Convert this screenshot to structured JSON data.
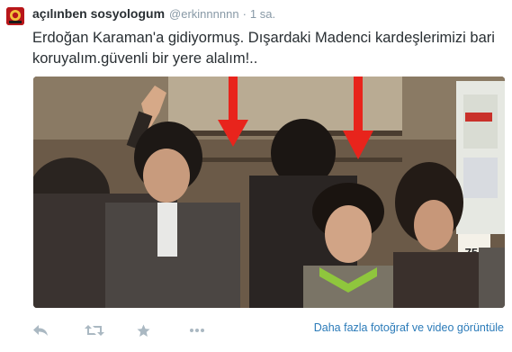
{
  "tweet": {
    "fullname": "açılınben sosyologum",
    "username": "@erkinnnnnn",
    "separator": "·",
    "time": "1 sa.",
    "text": "Erdoğan Karaman'a gidiyormuş. Dışardaki Madenci kardeşlerimizi bari koruyalım.güvenli bir yere alalım!..",
    "media": {
      "content": "photo",
      "sign_text": ".75",
      "arrow_color": "#e8241c"
    }
  },
  "actions": {
    "icons": [
      "reply-icon",
      "retweet-icon",
      "favorite-icon",
      "more-icon"
    ],
    "media_link": "Daha fazla fotoğraf ve video görüntüle"
  },
  "colors": {
    "link": "#2b7bb9",
    "muted": "#8899a6",
    "text": "#292f33",
    "icon": "#aab8c2"
  }
}
